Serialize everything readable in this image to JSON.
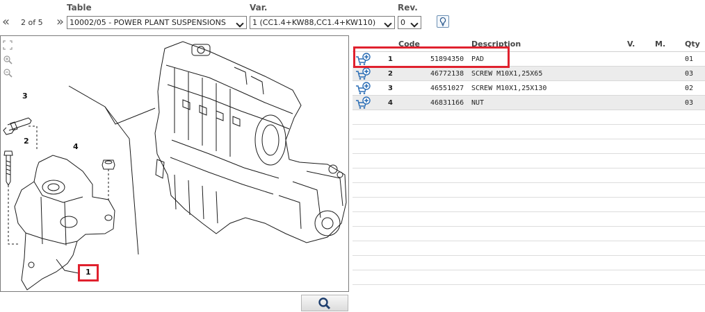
{
  "toolbar": {
    "table_label": "Table",
    "var_label": "Var.",
    "rev_label": "Rev.",
    "prev_glyph": "«",
    "next_glyph": "»",
    "pager_text": "2 of 5",
    "table_value": "10002/05 - POWER PLANT SUSPENSIONS",
    "var_value": "1 (CC1.4+KW88,CC1.4+KW110)",
    "rev_value": "0"
  },
  "drawing": {
    "callouts": [
      "3",
      "2",
      "4",
      "1"
    ],
    "highlighted_callout": "1"
  },
  "parts": {
    "columns": {
      "ref": "",
      "code": "Code",
      "description": "Description",
      "v": "V.",
      "m": "M.",
      "qty": "Qty"
    },
    "rows": [
      {
        "ref": "1",
        "code": "51894350",
        "description": "PAD",
        "v": "",
        "m": "",
        "qty": "01"
      },
      {
        "ref": "2",
        "code": "46772138",
        "description": "SCREW M10X1,25X65",
        "v": "",
        "m": "",
        "qty": "03"
      },
      {
        "ref": "3",
        "code": "46551027",
        "description": "SCREW M10X1,25X130",
        "v": "",
        "m": "",
        "qty": "02"
      },
      {
        "ref": "4",
        "code": "46831166",
        "description": "NUT",
        "v": "",
        "m": "",
        "qty": "03"
      }
    ],
    "highlighted_row": "1"
  },
  "colors": {
    "highlight": "#e0212e",
    "cart_icon": "#2a6db5",
    "alt_row": "#ececec"
  },
  "icons": {
    "cart": "cart-add-icon",
    "search": "magnifier-icon",
    "hint": "lightbulb-icon"
  }
}
